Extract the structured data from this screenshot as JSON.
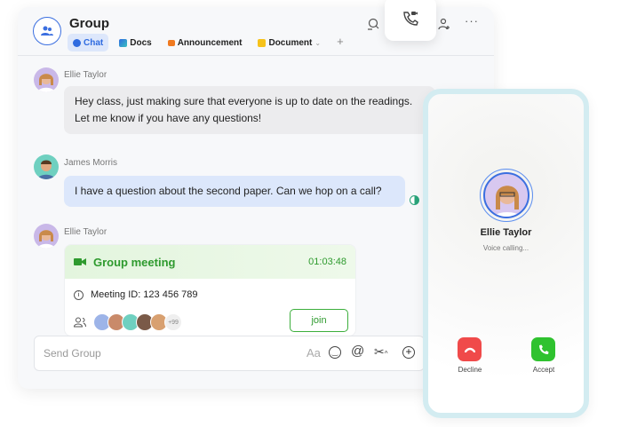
{
  "header": {
    "title": "Group",
    "tabs": [
      {
        "label": "Chat",
        "active": true
      },
      {
        "label": "Docs"
      },
      {
        "label": "Announcement"
      },
      {
        "label": "Document"
      }
    ],
    "add_tab": "+"
  },
  "messages": [
    {
      "sender": "Ellie Taylor",
      "text_lines": [
        "Hey class, just making sure that everyone is up to date on the readings.",
        "Let me know if you have any questions!"
      ]
    },
    {
      "sender": "James Morris",
      "text": "I have a question about the second paper. Can we hop on a call?"
    },
    {
      "sender": "Ellie Taylor"
    }
  ],
  "meeting": {
    "title": "Group meeting",
    "duration": "01:03:48",
    "meeting_id": "Meeting ID: 123 456 789",
    "extra_participants": "+99",
    "join_label": "join"
  },
  "composer": {
    "placeholder": "Send Group",
    "font_icon": "Aa"
  },
  "call": {
    "caller": "Ellie Taylor",
    "status": "Voice calling...",
    "decline_label": "Decline",
    "accept_label": "Accept"
  },
  "colors": {
    "accent": "#2f6be0",
    "green": "#2e9a2e",
    "decline": "#f04a4a",
    "accept": "#2fc22f"
  }
}
